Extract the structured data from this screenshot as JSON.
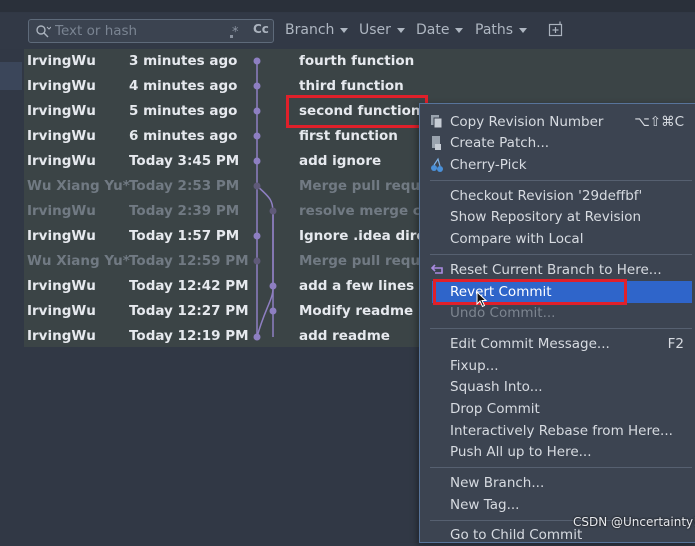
{
  "toolbar": {
    "search_placeholder": "Text or hash",
    "case_label": "Cc",
    "filters": [
      "Branch",
      "User",
      "Date",
      "Paths"
    ]
  },
  "commits": [
    {
      "author": "IrvingWu",
      "date": "3 minutes ago",
      "message": "fourth function",
      "dim": false
    },
    {
      "author": "IrvingWu",
      "date": "4 minutes ago",
      "message": "third function",
      "dim": false
    },
    {
      "author": "IrvingWu",
      "date": "5 minutes ago",
      "message": "second function",
      "dim": false
    },
    {
      "author": "IrvingWu",
      "date": "6 minutes ago",
      "message": "first function",
      "dim": false
    },
    {
      "author": "IrvingWu",
      "date": "Today 3:45 PM",
      "message": "add ignore",
      "dim": false
    },
    {
      "author": "Wu Xiang Yu*",
      "date": "Today 2:53 PM",
      "message": "Merge pull reque",
      "dim": true
    },
    {
      "author": "IrvingWu",
      "date": "Today 2:39 PM",
      "message": "resolve merge co",
      "dim": true
    },
    {
      "author": "IrvingWu",
      "date": "Today 1:57 PM",
      "message": "Ignore .idea direc",
      "dim": false
    },
    {
      "author": "Wu Xiang Yu*",
      "date": "Today 12:59 PM",
      "message": "Merge pull reque",
      "dim": true
    },
    {
      "author": "IrvingWu",
      "date": "Today 12:42 PM",
      "message": "add a few lines o",
      "dim": false
    },
    {
      "author": "IrvingWu",
      "date": "Today 12:27 PM",
      "message": "Modify readme b",
      "dim": false
    },
    {
      "author": "IrvingWu",
      "date": "Today 12:19 PM",
      "message": "add readme",
      "dim": false
    }
  ],
  "context_menu": {
    "items": [
      {
        "label": "Copy Revision Number",
        "shortcut": "⌥⇧⌘C",
        "icon": "copy-icon"
      },
      {
        "label": "Create Patch...",
        "icon": "patch-icon"
      },
      {
        "label": "Cherry-Pick",
        "icon": "cherry-icon"
      },
      {
        "label": "Checkout Revision '29deffbf'"
      },
      {
        "label": "Show Repository at Revision"
      },
      {
        "label": "Compare with Local"
      },
      {
        "label": "Reset Current Branch to Here...",
        "icon": "undo-arrow-icon"
      },
      {
        "label": "Revert Commit"
      },
      {
        "label": "Undo Commit..."
      },
      {
        "label": "Edit Commit Message...",
        "shortcut": "F2"
      },
      {
        "label": "Fixup..."
      },
      {
        "label": "Squash Into..."
      },
      {
        "label": "Drop Commit"
      },
      {
        "label": "Interactively Rebase from Here..."
      },
      {
        "label": "Push All up to Here..."
      },
      {
        "label": "New Branch..."
      },
      {
        "label": "New Tag..."
      },
      {
        "label": "Go to Child Commit"
      }
    ]
  },
  "watermark": "CSDN @Uncertainty!",
  "colors": {
    "selection": "#2f65ca",
    "highlight_box": "#e0202a",
    "graph_line": "#8e7fc2"
  }
}
